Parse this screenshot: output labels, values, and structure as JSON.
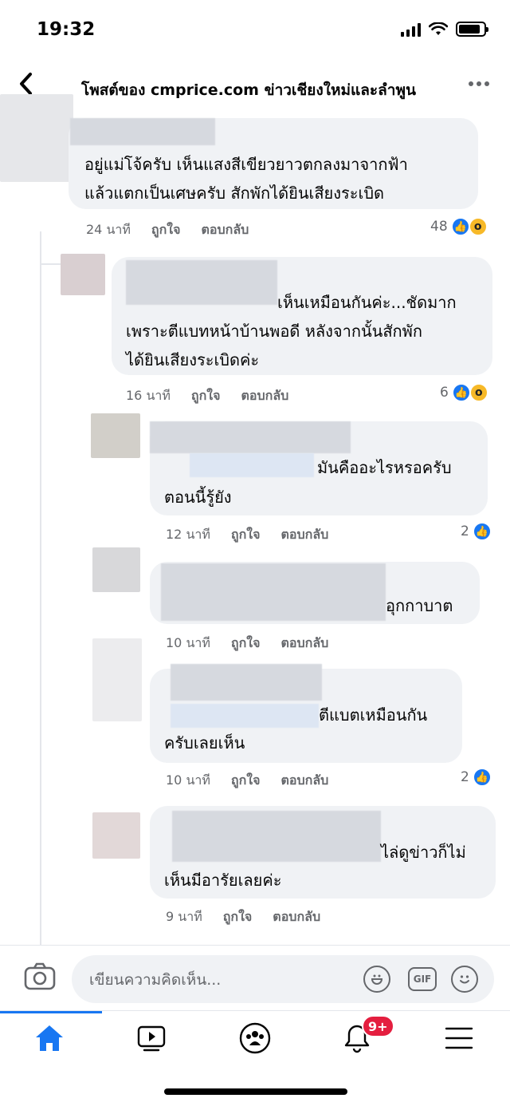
{
  "status_bar": {
    "time": "19:32",
    "battery_level": 0.85
  },
  "header": {
    "title": "โพสต์ของ cmprice.com ข่าวเชียงใหม่และลำพูน",
    "back_icon": "chevron-left-icon",
    "more_icon": "more-dots-icon"
  },
  "comments": [
    {
      "lines": [
        "อยู่แม่โจ้ครับ เห็นแสงสีเขียวยาวตกลงมาจากฟ้า",
        "แล้วแตกเป็นเศษครับ สักพักได้ยินเสียงระเบิด"
      ],
      "time": "24 นาที",
      "like_label": "ถูกใจ",
      "reply_label": "ตอบกลับ",
      "reaction_count": "48",
      "reactions": [
        "like",
        "wow"
      ]
    },
    {
      "lines": [
        "เห็นเหมือนกันค่ะ...ชัดมาก",
        "เพราะตีแบทหน้าบ้านพอดี หลังจากนั้นสักพัก",
        "ได้ยินเสียงระเบิดค่ะ"
      ],
      "time": "16 นาที",
      "like_label": "ถูกใจ",
      "reply_label": "ตอบกลับ",
      "reaction_count": "6",
      "reactions": [
        "like",
        "wow"
      ]
    },
    {
      "lines": [
        "มันคืออะไรหรอครับ",
        "ตอนนี้รู้ยัง"
      ],
      "time": "12 นาที",
      "like_label": "ถูกใจ",
      "reply_label": "ตอบกลับ",
      "reaction_count": "2",
      "reactions": [
        "like"
      ]
    },
    {
      "lines": [
        "อุกกาบาต"
      ],
      "time": "10 นาที",
      "like_label": "ถูกใจ",
      "reply_label": "ตอบกลับ",
      "reaction_count": "",
      "reactions": []
    },
    {
      "lines": [
        "ตีแบตเหมือนกัน",
        "ครับเลยเห็น"
      ],
      "time": "10 นาที",
      "like_label": "ถูกใจ",
      "reply_label": "ตอบกลับ",
      "reaction_count": "2",
      "reactions": [
        "like"
      ]
    },
    {
      "lines": [
        "ไล่ดูข่าวก็ไม่",
        "เห็นมีอารัยเลยค่ะ"
      ],
      "time": "9 นาที",
      "like_label": "ถูกใจ",
      "reply_label": "ตอบกลับ",
      "reaction_count": "",
      "reactions": []
    }
  ],
  "composer": {
    "placeholder": "เขียนความคิดเห็น...",
    "gif_label": "GIF"
  },
  "tabbar": {
    "notification_badge": "9+",
    "tabs": [
      "home-icon",
      "watch-icon",
      "groups-icon",
      "notifications-icon",
      "menu-icon"
    ]
  },
  "colors": {
    "accent": "#1877f2",
    "bubble": "#f0f2f5",
    "meta": "#65676b",
    "badge": "#e41e3f"
  }
}
